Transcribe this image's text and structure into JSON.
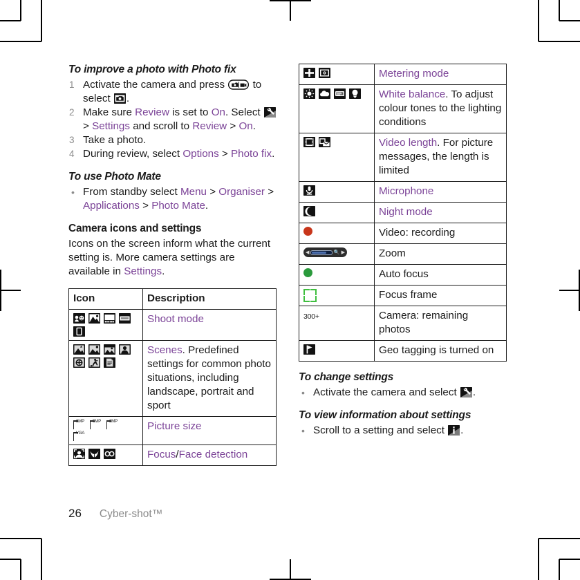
{
  "page": {
    "number": "26",
    "section": "Cyber-shot™",
    "accent_color": "#7b4397",
    "text_color": "#1b1b1b",
    "muted_color": "#8a8a8a"
  },
  "left_column": {
    "photofix": {
      "title": "To improve a photo with Photo fix",
      "steps": [
        {
          "parts": [
            {
              "t": "Activate the camera and press ",
              "k": "plain"
            },
            {
              "t": "camera-video-toggle-icon",
              "k": "icon"
            },
            {
              "t": " to select ",
              "k": "plain"
            },
            {
              "t": "still-camera-icon",
              "k": "icon"
            },
            {
              "t": ".",
              "k": "plain"
            }
          ]
        },
        {
          "parts": [
            {
              "t": "Make sure ",
              "k": "plain"
            },
            {
              "t": "Review",
              "k": "link"
            },
            {
              "t": " is set to ",
              "k": "plain"
            },
            {
              "t": "On",
              "k": "link"
            },
            {
              "t": ". Select ",
              "k": "plain"
            },
            {
              "t": "settings-wrench-icon",
              "k": "icon"
            },
            {
              "t": " > ",
              "k": "plain"
            },
            {
              "t": "Settings",
              "k": "link"
            },
            {
              "t": " and scroll to ",
              "k": "plain"
            },
            {
              "t": "Review",
              "k": "link"
            },
            {
              "t": " > ",
              "k": "plain"
            },
            {
              "t": "On",
              "k": "link"
            },
            {
              "t": ".",
              "k": "plain"
            }
          ]
        },
        {
          "parts": [
            {
              "t": "Take a photo.",
              "k": "plain"
            }
          ]
        },
        {
          "parts": [
            {
              "t": "During review, select ",
              "k": "plain"
            },
            {
              "t": "Options",
              "k": "link"
            },
            {
              "t": " > ",
              "k": "plain"
            },
            {
              "t": "Photo fix",
              "k": "link"
            },
            {
              "t": ".",
              "k": "plain"
            }
          ]
        }
      ]
    },
    "photomate": {
      "title": "To use Photo Mate",
      "bullets": [
        {
          "parts": [
            {
              "t": "From standby select ",
              "k": "plain"
            },
            {
              "t": "Menu",
              "k": "link"
            },
            {
              "t": " > ",
              "k": "plain"
            },
            {
              "t": "Organiser",
              "k": "link"
            },
            {
              "t": " > ",
              "k": "plain"
            },
            {
              "t": "Applications",
              "k": "link"
            },
            {
              "t": " > ",
              "k": "plain"
            },
            {
              "t": "Photo Mate",
              "k": "link"
            },
            {
              "t": ".",
              "k": "plain"
            }
          ]
        }
      ]
    },
    "camera_icons": {
      "title": "Camera icons and settings",
      "body_parts": [
        {
          "t": "Icons on the screen inform what the current setting is. More camera settings are available in ",
          "k": "plain"
        },
        {
          "t": "Settings",
          "k": "link"
        },
        {
          "t": ".",
          "k": "plain"
        }
      ]
    },
    "table": {
      "headers": [
        "Icon",
        "Description"
      ],
      "rows": [
        {
          "icons": [
            "portrait-smile-icon",
            "landscape-icon",
            "panorama-icon",
            "frames-icon",
            "burst-icon"
          ],
          "desc_parts": [
            {
              "t": "Shoot mode",
              "k": "link"
            }
          ]
        },
        {
          "icons": [
            "scene-auto-icon",
            "scene-landscape-icon",
            "scene-twilight-landscape-icon",
            "scene-portrait-icon",
            "scene-twilight-portrait-icon",
            "scene-sports-icon",
            "scene-document-icon"
          ],
          "desc_parts": [
            {
              "t": "Scenes",
              "k": "link"
            },
            {
              "t": ". Predefined settings for common photo situations, including landscape, portrait and sport",
              "k": "plain"
            }
          ]
        },
        {
          "icons": [
            "size-8mp-icon",
            "size-5mp-icon",
            "size-3mp-icon",
            "size-vga-icon"
          ],
          "icon_labels": [
            "8MP",
            "5MP",
            "3MP",
            "VGA"
          ],
          "desc_parts": [
            {
              "t": "Picture size",
              "k": "link"
            }
          ]
        },
        {
          "icons": [
            "face-detection-icon",
            "focus-macro-icon",
            "focus-infinity-icon"
          ],
          "desc_parts": [
            {
              "t": "Focus",
              "k": "link"
            },
            {
              "t": "/",
              "k": "plain"
            },
            {
              "t": "Face detection",
              "k": "link"
            }
          ]
        }
      ]
    }
  },
  "right_column": {
    "table": {
      "rows": [
        {
          "icons": [
            "metering-normal-icon",
            "metering-spot-icon"
          ],
          "desc_parts": [
            {
              "t": "Metering mode",
              "k": "link"
            }
          ]
        },
        {
          "icons": [
            "wb-daylight-icon",
            "wb-cloudy-icon",
            "wb-fluorescent-icon",
            "wb-incandescent-icon"
          ],
          "desc_parts": [
            {
              "t": "White balance",
              "k": "link"
            },
            {
              "t": ". To adjust colour tones to the lighting conditions",
              "k": "plain"
            }
          ]
        },
        {
          "icons": [
            "video-length-full-icon",
            "video-length-message-icon"
          ],
          "desc_parts": [
            {
              "t": "Video length",
              "k": "link"
            },
            {
              "t": ". For picture messages, the length is limited",
              "k": "plain"
            }
          ]
        },
        {
          "icons": [
            "microphone-icon"
          ],
          "desc_parts": [
            {
              "t": "Microphone",
              "k": "link"
            }
          ]
        },
        {
          "icons": [
            "night-mode-icon"
          ],
          "desc_parts": [
            {
              "t": "Night mode",
              "k": "link"
            }
          ]
        },
        {
          "icons": [
            "recording-dot-icon"
          ],
          "desc_parts": [
            {
              "t": "Video: recording",
              "k": "plain"
            }
          ]
        },
        {
          "icons": [
            "zoom-slider-icon"
          ],
          "desc_parts": [
            {
              "t": "Zoom",
              "k": "plain"
            }
          ]
        },
        {
          "icons": [
            "auto-focus-dot-icon"
          ],
          "desc_parts": [
            {
              "t": "Auto focus",
              "k": "plain"
            }
          ]
        },
        {
          "icons": [
            "focus-frame-icon"
          ],
          "desc_parts": [
            {
              "t": "Focus frame",
              "k": "plain"
            }
          ]
        },
        {
          "icons": [
            "remaining-photos-icon"
          ],
          "icon_text": "300+",
          "desc_parts": [
            {
              "t": "Camera: remaining photos",
              "k": "plain"
            }
          ]
        },
        {
          "icons": [
            "geo-tagging-flag-icon"
          ],
          "desc_parts": [
            {
              "t": "Geo tagging is turned on",
              "k": "plain"
            }
          ]
        }
      ]
    },
    "change_settings": {
      "title": "To change settings",
      "bullets": [
        {
          "parts": [
            {
              "t": "Activate the camera and select ",
              "k": "plain"
            },
            {
              "t": "settings-wrench-icon",
              "k": "icon"
            },
            {
              "t": ".",
              "k": "plain"
            }
          ]
        }
      ]
    },
    "view_info": {
      "title": "To view information about settings",
      "bullets": [
        {
          "parts": [
            {
              "t": "Scroll to a setting and select ",
              "k": "plain"
            },
            {
              "t": "info-icon",
              "k": "icon"
            },
            {
              "t": ".",
              "k": "plain"
            }
          ]
        }
      ]
    }
  }
}
